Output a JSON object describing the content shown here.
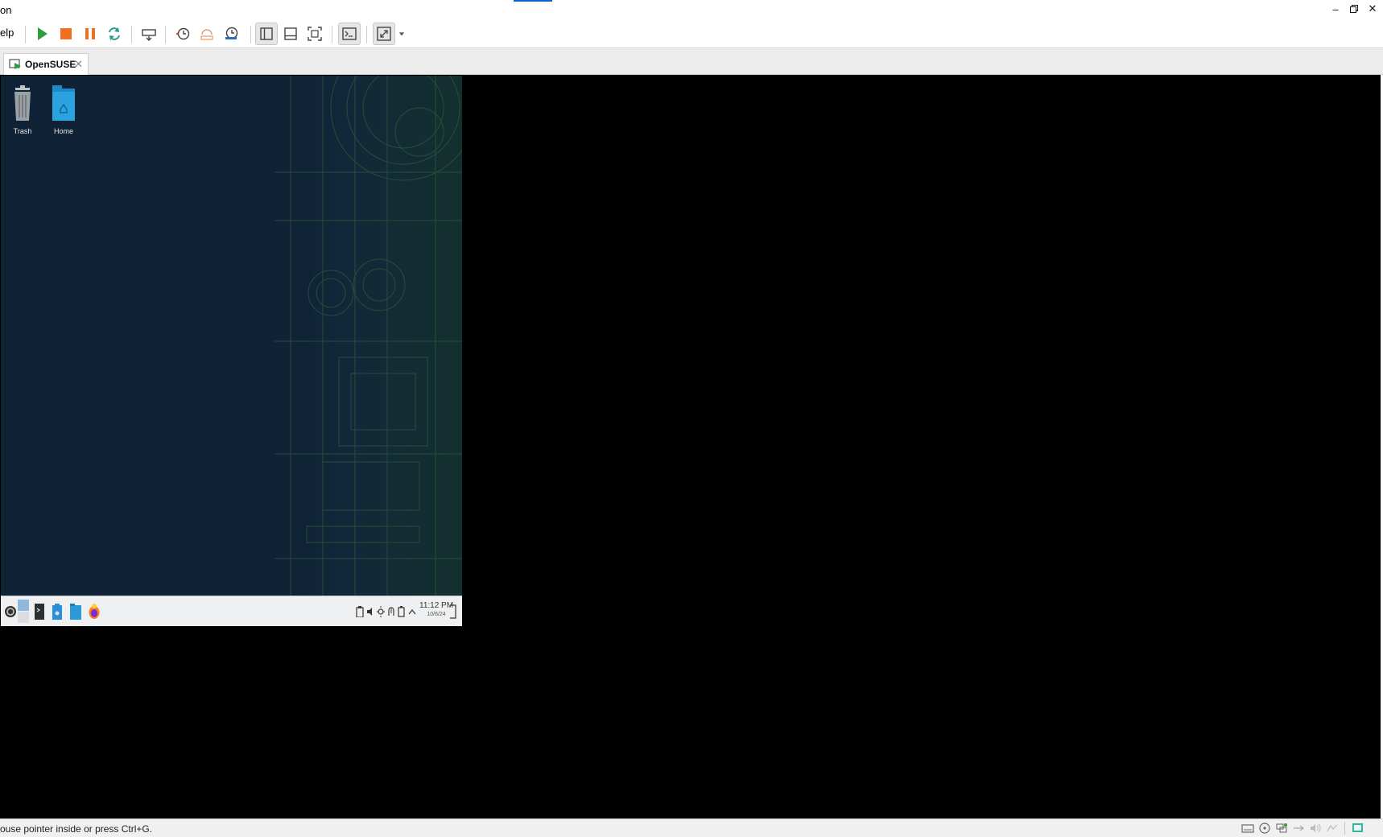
{
  "window": {
    "title_partial": "on",
    "controls": {
      "minimize": "–",
      "restore": "▫",
      "close": "✕"
    }
  },
  "toolbar": {
    "menu_help": "Help",
    "menu_help_visible": "elp",
    "buttons": [
      {
        "name": "power-on",
        "icon": "play-icon",
        "color": "#2e9e3a"
      },
      {
        "name": "power-off",
        "icon": "stop-icon",
        "color": "#f07020"
      },
      {
        "name": "suspend",
        "icon": "pause-icon",
        "color": "#f07020"
      },
      {
        "name": "restart",
        "icon": "refresh-icon",
        "color": "#2a9d8f"
      },
      {
        "name": "send-ctrl-alt-del",
        "icon": "keyboard-icon"
      },
      {
        "name": "snapshot",
        "icon": "snapshot-clock-icon"
      },
      {
        "name": "revert-snapshot",
        "icon": "revert-snapshot-icon"
      },
      {
        "name": "snapshot-manager",
        "icon": "snapshot-manager-icon"
      },
      {
        "name": "show-library",
        "icon": "library-panel-icon",
        "pressed": true
      },
      {
        "name": "thumbnail-bar",
        "icon": "thumbnail-bar-icon"
      },
      {
        "name": "full-screen",
        "icon": "fullscreen-icon"
      },
      {
        "name": "console-view",
        "icon": "console-icon",
        "pressed": true
      },
      {
        "name": "stretch-guest",
        "icon": "stretch-icon",
        "pressed": true
      }
    ]
  },
  "tabs": [
    {
      "label": "OpenSUSE",
      "active": true,
      "close": "✕"
    }
  ],
  "guest": {
    "desktop_icons": [
      {
        "label": "Trash",
        "icon": "trash-icon"
      },
      {
        "label": "Home",
        "icon": "home-folder-icon"
      }
    ],
    "taskbar": {
      "launchers": [
        "application-menu-icon",
        "pager-icon",
        "terminal-icon",
        "discover-icon",
        "file-manager-icon",
        "firefox-icon"
      ],
      "tray": [
        "clipboard-icon",
        "volume-icon",
        "brightness-icon",
        "updates-icon",
        "battery-icon",
        "tray-expand-icon"
      ],
      "clock_time": "11:12 PM",
      "clock_date": "10/6/24"
    }
  },
  "statusbar": {
    "message": "ouse pointer inside or press Ctrl+G.",
    "icons": [
      "hard-disk-icon",
      "cd-icon",
      "network-icon",
      "usb-icon",
      "sound-icon",
      "display-icon",
      "message-icon"
    ]
  },
  "colors": {
    "console_bg": "#000000",
    "guest_desktop": "#0f2236",
    "taskbar": "#eff0f1",
    "accent": "#0a64c8"
  }
}
